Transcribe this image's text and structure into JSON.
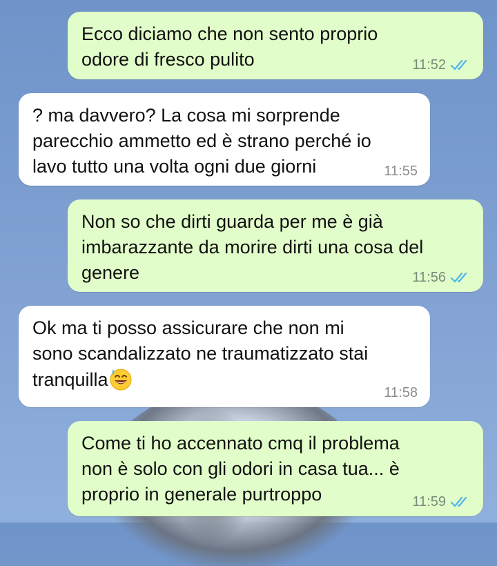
{
  "messages": [
    {
      "direction": "outgoing",
      "text": "Ecco diciamo che non sento proprio\nodore di fresco pulito",
      "time": "11:52",
      "read": true
    },
    {
      "direction": "incoming",
      "text": "? ma davvero? La cosa mi sorprende\nparecchio ammetto ed è strano perché io\nlavo tutto una volta ogni due giorni",
      "time": "11:55"
    },
    {
      "direction": "outgoing",
      "text": "Non so che dirti guarda per me è già\nimbarazzante da morire dirti una cosa del\ngenere",
      "time": "11:56",
      "read": true
    },
    {
      "direction": "incoming",
      "text": "Ok ma ti posso assicurare che non mi\nsono scandalizzato ne traumatizzato stai\ntranquilla",
      "emoji": "grinning-face-with-sweat",
      "time": "11:58"
    },
    {
      "direction": "outgoing",
      "text": "Come ti ho accennato cmq il problema\nnon è solo con gli odori in casa tua... è\nproprio in generale purtroppo",
      "time": "11:59",
      "read": true
    }
  ],
  "colors": {
    "outgoing_bubble": "#e1fdc9",
    "incoming_bubble": "#ffffff",
    "read_ticks": "#4fb6ec"
  }
}
